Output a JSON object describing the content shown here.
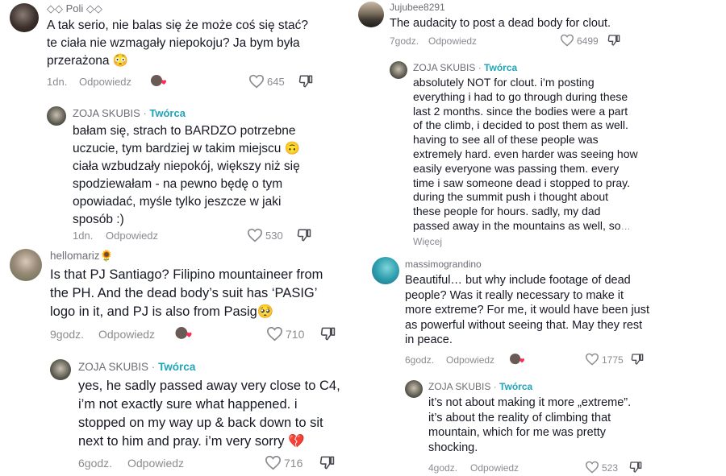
{
  "panel_a": {
    "comment": {
      "username": "◇◇ Poli ◇◇",
      "text": "A tak serio, nie balas się że może coś się stać? te ciała nie wzmagały niepokoju? Ja bym była przerażona 😳",
      "time": "1dn.",
      "reply": "Odpowiedz",
      "likes": "645"
    },
    "response": {
      "username": "ZOJA SKUBIS",
      "separator": "·",
      "creator": "Twórca",
      "text": "bałam się, strach to BARDZO potrzebne uczucie, tym bardziej w takim miejscu 🙃 ciała wzbudzały niepokój, większy niż się spodziewałam - na pewno będę o tym opowiadać, myśle tylko jeszcze w jaki sposób :)",
      "time": "1dn.",
      "reply": "Odpowiedz",
      "likes": "530"
    }
  },
  "panel_b": {
    "comment": {
      "username": "hellomariz🌻",
      "text": "Is that PJ Santiago? Filipino mountaineer from the PH. And the dead body’s suit has ‘PASIG’ logo in it, and PJ is also from Pasig🥺",
      "time": "9godz.",
      "reply": "Odpowiedz",
      "likes": "710"
    },
    "response": {
      "username": "ZOJA SKUBIS",
      "separator": "·",
      "creator": "Twórca",
      "text": "yes, he sadly passed away very close to C4, i’m not exactly sure what happened. i stopped on my way up & back down to sit next to him and pray. i’m very sorry 💔",
      "time": "6godz.",
      "reply": "Odpowiedz",
      "likes": "716"
    }
  },
  "panel_c": {
    "comment": {
      "username": "Jujubee8291",
      "text": "The audacity to post a dead body for clout.",
      "time": "7godz.",
      "reply": "Odpowiedz",
      "likes": "6499"
    },
    "response": {
      "username": "ZOJA SKUBIS",
      "separator": "·",
      "creator": "Twórca",
      "text": "absolutely NOT for clout. i’m posting everything i had to go through during these last 2 months. since the bodies were a part of the climb, i decided to post them as well. having to see all of these people was extremely hard. even harder was seeing how easily everyone was passing them. every time i saw someone dead i stopped to pray. during the summit push i thought about these people for hours. sadly, my dad passed away in the mountains as well, so",
      "more": "… Więcej"
    }
  },
  "panel_d": {
    "comment": {
      "username": "massimograndino",
      "text": "Beautiful… but why include footage of dead people? Was it really necessary to make it more extreme? For me, it would have been just as powerful without seeing that. May they rest in peace.",
      "time": "6godz.",
      "reply": "Odpowiedz",
      "likes": "1775"
    },
    "response": {
      "username": "ZOJA SKUBIS",
      "separator": "·",
      "creator": "Twórca",
      "text": "it’s not about making it more „extreme”. it’s about the reality of climbing that mountain, which for me was pretty shocking.",
      "time": "4godz.",
      "reply": "Odpowiedz",
      "likes": "523"
    }
  },
  "colors": {
    "creator": "#20a4b8",
    "text": "#161823",
    "meta": "#8a8b91",
    "liked_heart": "#fe2c55"
  },
  "icons": [
    "heart-outline-icon",
    "dislike-icon",
    "creator-liked-heart-icon"
  ]
}
